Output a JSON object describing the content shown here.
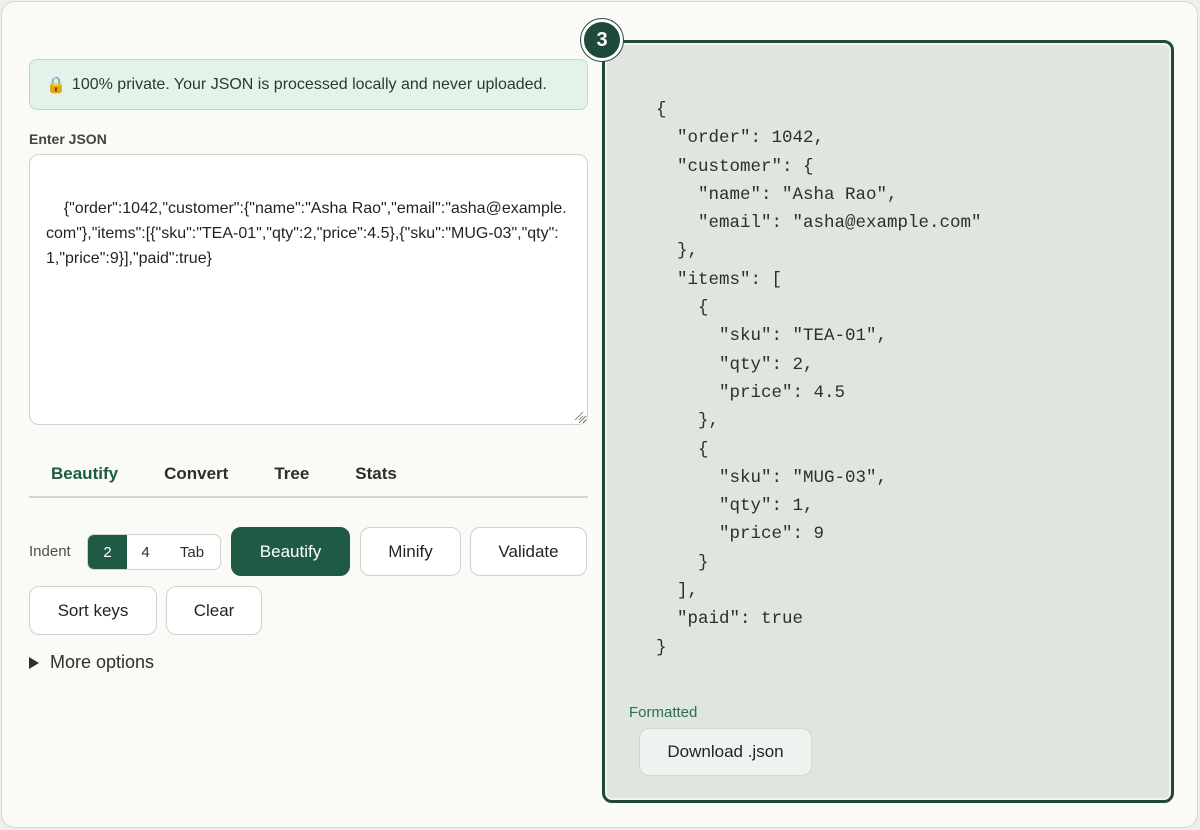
{
  "privacy": {
    "icon": "lock-icon",
    "icon_glyph": "🔒",
    "text": "100% private. Your JSON is processed locally and never uploaded."
  },
  "input": {
    "label": "Enter JSON",
    "value": "{\"order\":1042,\"customer\":{\"name\":\"Asha Rao\",\"email\":\"asha@example.com\"},\"items\":[{\"sku\":\"TEA-01\",\"qty\":2,\"price\":4.5},{\"sku\":\"MUG-03\",\"qty\":1,\"price\":9}],\"paid\":true}"
  },
  "tabs": [
    {
      "label": "Beautify",
      "active": true
    },
    {
      "label": "Convert",
      "active": false
    },
    {
      "label": "Tree",
      "active": false
    },
    {
      "label": "Stats",
      "active": false
    }
  ],
  "indent": {
    "label": "Indent",
    "options": [
      "2",
      "4",
      "Tab"
    ],
    "selected": "2"
  },
  "actions": {
    "beautify": "Beautify",
    "minify": "Minify",
    "validate": "Validate",
    "sort_keys": "Sort keys",
    "clear": "Clear"
  },
  "more_options": "More options",
  "output": {
    "step": "3",
    "code": "{\n  \"order\": 1042,\n  \"customer\": {\n    \"name\": \"Asha Rao\",\n    \"email\": \"asha@example.com\"\n  },\n  \"items\": [\n    {\n      \"sku\": \"TEA-01\",\n      \"qty\": 2,\n      \"price\": 4.5\n    },\n    {\n      \"sku\": \"MUG-03\",\n      \"qty\": 1,\n      \"price\": 9\n    }\n  ],\n  \"paid\": true\n}",
    "status": "Formatted",
    "download": "Download .json"
  },
  "colors": {
    "accent": "#1f5a45",
    "panel_border": "#1f4a3b",
    "panel_bg": "#dfe5df",
    "privacy_bg": "#e4f3ea"
  }
}
